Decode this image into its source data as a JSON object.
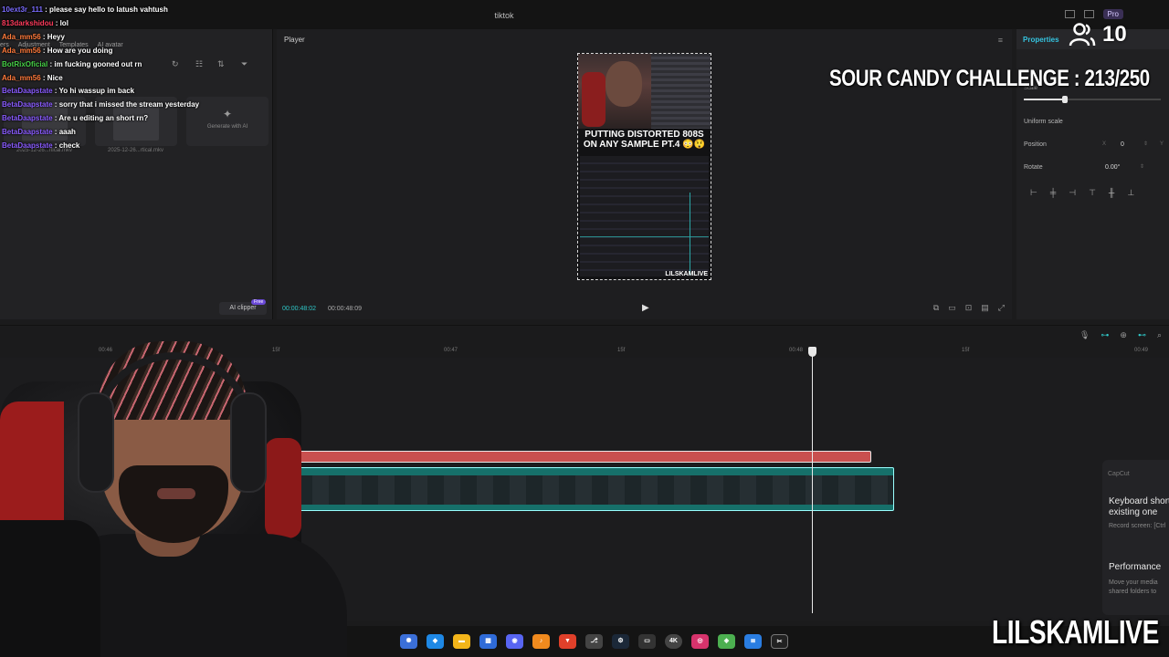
{
  "window": {
    "title": "tiktok",
    "pro_label": "Pro"
  },
  "left_panel": {
    "tabs": [
      "ers",
      "Adjustment",
      "Templates",
      "AI avatar"
    ],
    "sort_label": "↻",
    "media": [
      {
        "caption": "2025-12-26...rtical.mkv"
      },
      {
        "caption": "2025-12-26...rtical.mkv"
      }
    ],
    "generate_label": "Generate with AI",
    "ai_clipper_label": "AI clipper",
    "free_badge": "Free"
  },
  "chat": {
    "messages": [
      {
        "user": "10ext3r_111",
        "text": ": please say hello to latush vahtush",
        "color": "#7b6cff"
      },
      {
        "user": "813darkshidou",
        "text": ": lol",
        "color": "#ff3b5c"
      },
      {
        "user": "Ada_mm56",
        "text": ": Heyy",
        "color": "#ff7a3b"
      },
      {
        "user": "Ada_mm56",
        "text": ": How are you doing",
        "color": "#ff7a3b"
      },
      {
        "user": "BotRixOficial",
        "text": ": im fucking gooned out rn",
        "color": "#47d147"
      },
      {
        "user": "Ada_mm56",
        "text": ": Nice",
        "color": "#ff7a3b"
      },
      {
        "user": "BetaDaapstate",
        "text": ": Yo hi wassup im back",
        "color": "#8a5cff"
      },
      {
        "user": "BetaDaapstate",
        "text": ": sorry that i missed the stream yesterday",
        "color": "#8a5cff"
      },
      {
        "user": "BetaDaapstate",
        "text": ": Are u editing an short rn?",
        "color": "#8a5cff"
      },
      {
        "user": "BetaDaapstate",
        "text": ": aaah",
        "color": "#8a5cff"
      },
      {
        "user": "BetaDaapstate",
        "text": ": check",
        "color": "#8a5cff"
      }
    ]
  },
  "player": {
    "header": "Player",
    "caption": "PUTTING DISTORTED 808S ON ANY SAMPLE PT.4 😳😲",
    "watermark": "LILSKAMLIVE",
    "timecode_current": "00:00:48:02",
    "timecode_total": "00:00:48:09"
  },
  "properties": {
    "tab": "Properties",
    "scale_label": "Scale",
    "scale_fraction": 0.3,
    "uniform_scale": "Uniform scale",
    "position_label": "Position",
    "position_x_axis": "X",
    "position_x": "0",
    "position_y_axis": "Y",
    "rotate_label": "Rotate",
    "rotate_value": "0.00°"
  },
  "overlay": {
    "viewer_count": "10",
    "challenge": "SOUR CANDY CHALLENGE : 213/250",
    "brand": "LILSKAMLIVE"
  },
  "timeline": {
    "ruler_labels": [
      "00:46",
      "15f",
      "00:47",
      "15f",
      "00:48",
      "15f",
      "00:49"
    ]
  },
  "notification": {
    "app": "CapCut",
    "title1": "Keyboard shortcuts",
    "title1b": "existing one",
    "sub1": "Record screen: [Ctrl",
    "title2": "Performance",
    "sub2a": "Move your media",
    "sub2b": "shared folders to"
  },
  "taskbar": {
    "icons": [
      "bubbles",
      "copilot",
      "files",
      "store",
      "discord",
      "fl-studio",
      "brave",
      "git",
      "steam",
      "cpu",
      "4k-downloader",
      "instagram",
      "layers",
      "notepad",
      "capcut"
    ]
  }
}
